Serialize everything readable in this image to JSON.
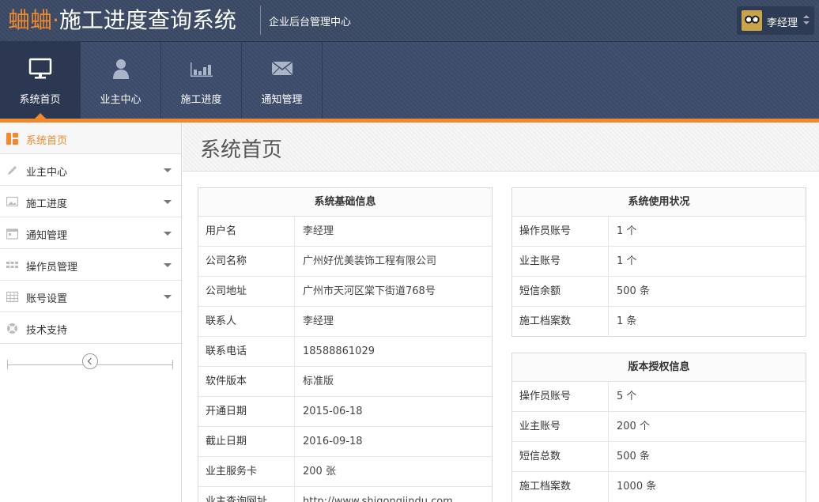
{
  "header": {
    "brand_prefix": "蛐蛐·",
    "brand_name": "施工进度查询系统",
    "subtitle": "企业后台管理中心",
    "user_name": "李经理"
  },
  "topnav": [
    {
      "label": "系统首页",
      "icon": "monitor-icon",
      "active": true
    },
    {
      "label": "业主中心",
      "icon": "user-icon"
    },
    {
      "label": "施工进度",
      "icon": "bar-chart-icon"
    },
    {
      "label": "通知管理",
      "icon": "envelope-icon"
    }
  ],
  "sidebar": {
    "items": [
      {
        "label": "系统首页",
        "icon": "dashboard-icon",
        "active": true
      },
      {
        "label": "业主中心",
        "icon": "pencil-icon",
        "expandable": true
      },
      {
        "label": "施工进度",
        "icon": "image-icon",
        "expandable": true
      },
      {
        "label": "通知管理",
        "icon": "calendar-icon",
        "expandable": true
      },
      {
        "label": "操作员管理",
        "icon": "grid-icon",
        "expandable": true
      },
      {
        "label": "账号设置",
        "icon": "table-icon",
        "expandable": true
      },
      {
        "label": "技术支持",
        "icon": "lifebuoy-icon"
      }
    ]
  },
  "main": {
    "title": "系统首页",
    "basic_info": {
      "title": "系统基础信息",
      "rows": [
        {
          "key": "用户名",
          "value": "李经理"
        },
        {
          "key": "公司名称",
          "value": "广州好优美装饰工程有限公司"
        },
        {
          "key": "公司地址",
          "value": "广州市天河区棠下街道768号"
        },
        {
          "key": "联系人",
          "value": "李经理"
        },
        {
          "key": "联系电话",
          "value": "18588861029"
        },
        {
          "key": "软件版本",
          "value": "标准版"
        },
        {
          "key": "开通日期",
          "value": "2015-06-18"
        },
        {
          "key": "截止日期",
          "value": "2016-09-18"
        },
        {
          "key": "业主服务卡",
          "value": "200 张"
        },
        {
          "key": "业主查询网址",
          "value": "http://www.shigongjindu.com"
        }
      ]
    },
    "usage": {
      "title": "系统使用状况",
      "rows": [
        {
          "key": "操作员账号",
          "value": "1 个"
        },
        {
          "key": "业主账号",
          "value": "1 个"
        },
        {
          "key": "短信余额",
          "value": "500 条"
        },
        {
          "key": "施工档案数",
          "value": "1 条"
        }
      ]
    },
    "license": {
      "title": "版本授权信息",
      "rows": [
        {
          "key": "操作员账号",
          "value": "5 个"
        },
        {
          "key": "业主账号",
          "value": "200 个"
        },
        {
          "key": "短信总数",
          "value": "500 条"
        },
        {
          "key": "施工档案数",
          "value": "1000 条"
        }
      ]
    }
  },
  "colors": {
    "accent": "#f08a2c",
    "header_bg": "#3b4a66"
  }
}
